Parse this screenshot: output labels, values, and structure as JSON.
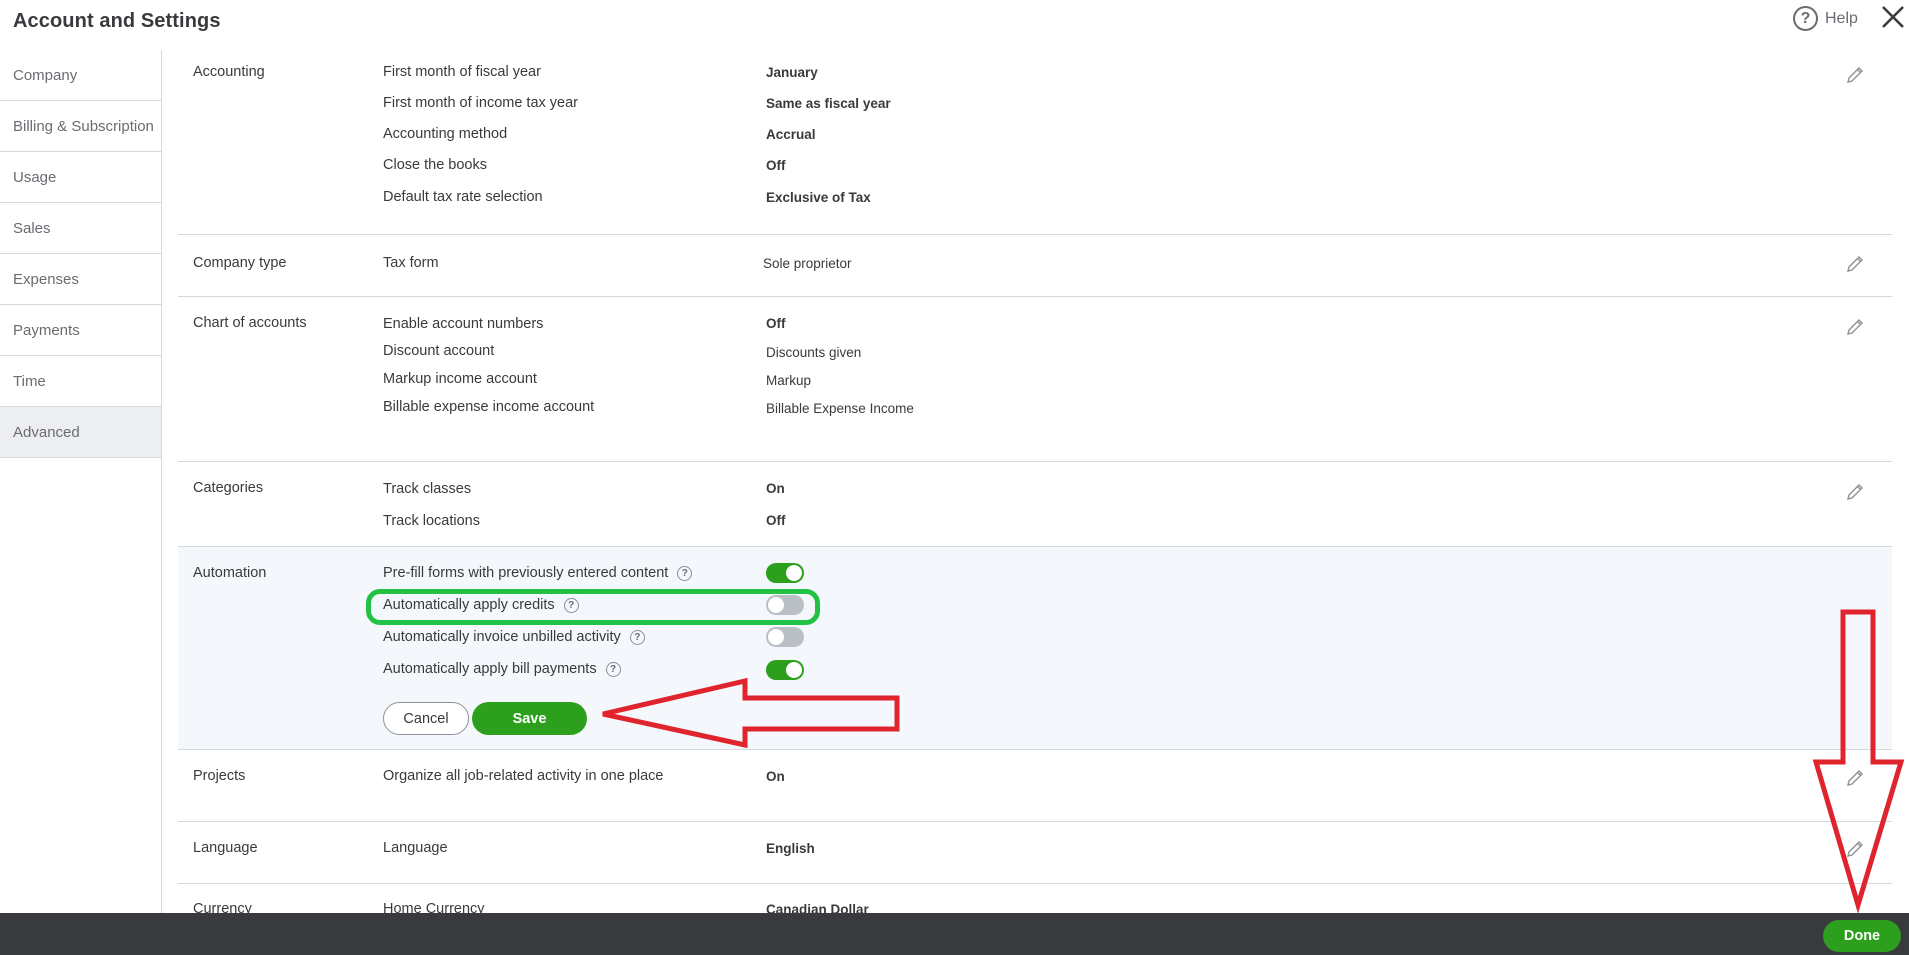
{
  "header": {
    "title": "Account and Settings",
    "help_label": "Help",
    "help_icon": "question-circle-icon",
    "close_icon": "close-icon"
  },
  "sidebar": {
    "items": [
      {
        "label": "Company"
      },
      {
        "label": "Billing & Subscription"
      },
      {
        "label": "Usage"
      },
      {
        "label": "Sales"
      },
      {
        "label": "Expenses"
      },
      {
        "label": "Payments"
      },
      {
        "label": "Time"
      },
      {
        "label": "Advanced",
        "active": true
      }
    ]
  },
  "sections": {
    "accounting": {
      "title": "Accounting",
      "rows": [
        {
          "label": "First month of fiscal year",
          "value": "January"
        },
        {
          "label": "First month of income tax year",
          "value": "Same as fiscal year"
        },
        {
          "label": "Accounting method",
          "value": "Accrual"
        },
        {
          "label": "Close the books",
          "value": "Off"
        },
        {
          "label": "Default tax rate selection",
          "value": "Exclusive of Tax"
        }
      ]
    },
    "company_type": {
      "title": "Company type",
      "rows": [
        {
          "label": "Tax form",
          "value": "Sole proprietor"
        }
      ]
    },
    "chart_of_accounts": {
      "title": "Chart of accounts",
      "rows": [
        {
          "label": "Enable account numbers",
          "value": "Off"
        },
        {
          "label": "Discount account",
          "value": "Discounts given"
        },
        {
          "label": "Markup income account",
          "value": "Markup"
        },
        {
          "label": "Billable expense income account",
          "value": "Billable Expense Income"
        }
      ]
    },
    "categories": {
      "title": "Categories",
      "rows": [
        {
          "label": "Track classes",
          "value": "On"
        },
        {
          "label": "Track locations",
          "value": "Off"
        }
      ]
    },
    "automation": {
      "title": "Automation",
      "rows": [
        {
          "label": "Pre-fill forms with previously entered content",
          "enabled": true
        },
        {
          "label": "Automatically apply credits",
          "enabled": false
        },
        {
          "label": "Automatically invoice unbilled activity",
          "enabled": false
        },
        {
          "label": "Automatically apply bill payments",
          "enabled": true
        }
      ],
      "cancel_label": "Cancel",
      "save_label": "Save"
    },
    "projects": {
      "title": "Projects",
      "rows": [
        {
          "label": "Organize all job-related activity in one place",
          "value": "On"
        }
      ]
    },
    "language": {
      "title": "Language",
      "rows": [
        {
          "label": "Language",
          "value": "English"
        }
      ]
    },
    "currency": {
      "title": "Currency",
      "rows": [
        {
          "label": "Home Currency",
          "value": "Canadian Dollar"
        }
      ]
    }
  },
  "footer": {
    "done_label": "Done"
  },
  "annotations": {
    "highlight_color": "#22c244",
    "arrow_color": "#e0242e"
  },
  "colors": {
    "accent_green": "#2ca01c",
    "footer_bg": "#393a3d",
    "edit_bg": "#f4f7fb"
  }
}
